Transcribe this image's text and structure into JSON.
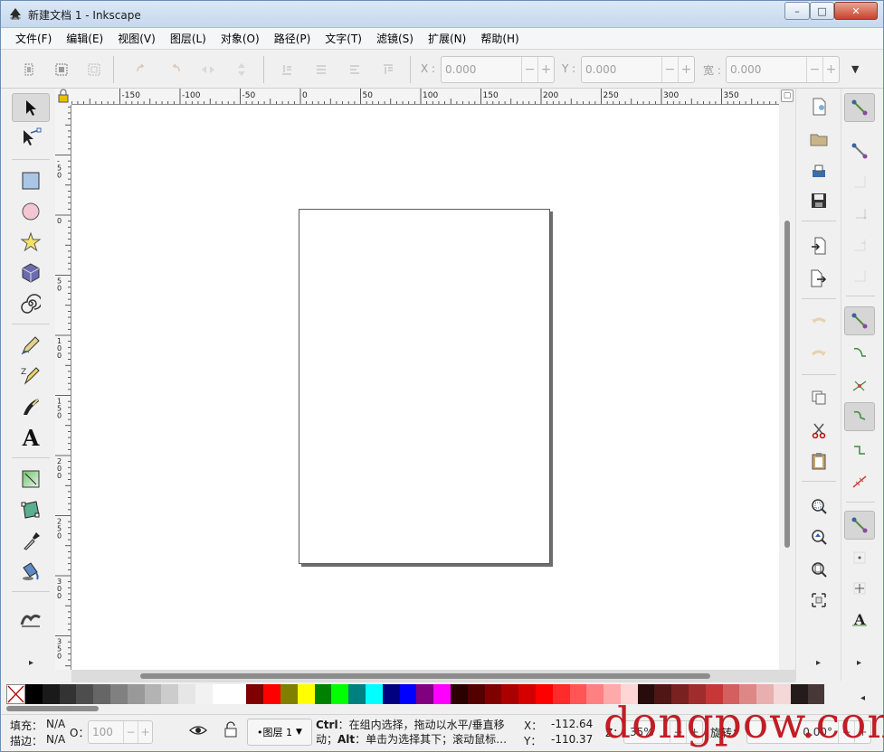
{
  "window": {
    "title": "新建文档 1 - Inkscape",
    "minimize": "–",
    "maximize": "□",
    "close": "✕"
  },
  "menu": [
    "文件(F)",
    "编辑(E)",
    "视图(V)",
    "图层(L)",
    "对象(O)",
    "路径(P)",
    "文字(T)",
    "滤镜(S)",
    "扩展(N)",
    "帮助(H)"
  ],
  "toolbar": {
    "x_label": "X :",
    "x_value": "0.000",
    "y_label": "Y :",
    "y_value": "0.000",
    "w_label": "宽 :",
    "w_value": "0.000",
    "minus": "−",
    "plus": "+",
    "more": "▼"
  },
  "rulers": {
    "top_labels": [
      "-150",
      "-100",
      "-50",
      "0",
      "50",
      "100",
      "150",
      "200",
      "250",
      "300",
      "350"
    ],
    "left_labels": [
      "-50",
      "0",
      "50",
      "100",
      "150",
      "200",
      "250",
      "300",
      "350"
    ]
  },
  "tools": [
    {
      "name": "selector-tool",
      "icon": "arrow",
      "active": true
    },
    {
      "name": "node-tool",
      "icon": "node"
    },
    {
      "name": "rect-tool",
      "icon": "rect"
    },
    {
      "name": "ellipse-tool",
      "icon": "ellipse"
    },
    {
      "name": "star-tool",
      "icon": "star"
    },
    {
      "name": "3dbox-tool",
      "icon": "box"
    },
    {
      "name": "spiral-tool",
      "icon": "spiral"
    },
    {
      "name": "pencil-tool",
      "icon": "pencil"
    },
    {
      "name": "pen-tool",
      "icon": "pen"
    },
    {
      "name": "calligraphy-tool",
      "icon": "calligraphy"
    },
    {
      "name": "text-tool",
      "icon": "text"
    },
    {
      "name": "gradient-tool",
      "icon": "gradient"
    },
    {
      "name": "mesh-tool",
      "icon": "mesh"
    },
    {
      "name": "dropper-tool",
      "icon": "dropper"
    },
    {
      "name": "paint-bucket-tool",
      "icon": "bucket"
    },
    {
      "name": "tweak-tool",
      "icon": "tweak"
    }
  ],
  "text_tool_glyph": "A",
  "expand_arrow": "▸",
  "palette": {
    "colors": [
      "#000000",
      "#1a1a1a",
      "#333333",
      "#4d4d4d",
      "#666666",
      "#808080",
      "#999999",
      "#b3b3b3",
      "#cccccc",
      "#e6e6e6",
      "#f2f2f2",
      "#ffffff",
      "#ffffff",
      "#800000",
      "#ff0000",
      "#808000",
      "#ffff00",
      "#008000",
      "#00ff00",
      "#008080",
      "#00ffff",
      "#000080",
      "#0000ff",
      "#800080",
      "#ff00ff",
      "#2b0000",
      "#550000",
      "#800000",
      "#aa0000",
      "#d40000",
      "#ff0000",
      "#ff2a2a",
      "#ff5555",
      "#ff8080",
      "#ffaaaa",
      "#ffd5d5",
      "#280b0b",
      "#501616",
      "#782121",
      "#a02c2c",
      "#c83737",
      "#d35f5f",
      "#de8787",
      "#e9afaf",
      "#f4d7d7",
      "#241c1c",
      "#483737"
    ],
    "menu_arrow": "◂"
  },
  "status": {
    "fill_label": "填充：",
    "fill_value": "N/A",
    "stroke_label": "描边：",
    "stroke_value": "N/A",
    "opacity_label": "O：",
    "opacity_value": "100",
    "layer": "•图层 1",
    "layer_arrow": "▼",
    "message_key1": "Ctrl",
    "message_part1": "：在组内选择，拖动以水平/垂直移动；",
    "message_key2": "Alt",
    "message_part2": "：单击为选择其下；滚动鼠标…",
    "x_label": "X：",
    "x_value": "-112.64",
    "y_label": "Y：",
    "y_value": "-110.37",
    "zoom_label": "Z：",
    "zoom_value": "35%",
    "rotation_label": "旋转：",
    "rotation_value": "0.00°"
  },
  "watermark": "dongpow.com",
  "colors": {
    "accent": "#c0121b",
    "page_shadow": "#6d6d6d"
  }
}
